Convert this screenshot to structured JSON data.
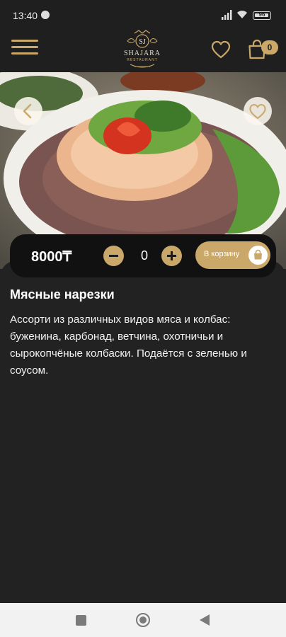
{
  "status_bar": {
    "time": "13:40",
    "battery": "96"
  },
  "header": {
    "logo_monogram": "SJ",
    "logo_text": "SHAJARA",
    "logo_subtext": "RESTAURANT",
    "cart_count": "0",
    "accent_color": "#c9a86a"
  },
  "product": {
    "title": "Мясные нарезки",
    "description": "Ассорти из различных видов мяса и колбас: буженина, карбонад, ветчина, охотничьи и сырокопчёные колбаски. Подаётся с зеленью и соусом.",
    "price": "8000₸",
    "quantity": "0",
    "add_to_cart_label": "В корзину"
  },
  "icons": {
    "menu": "hamburger-icon",
    "favorite": "heart-icon",
    "cart": "shopping-bag-icon",
    "back": "chevron-left-icon"
  }
}
